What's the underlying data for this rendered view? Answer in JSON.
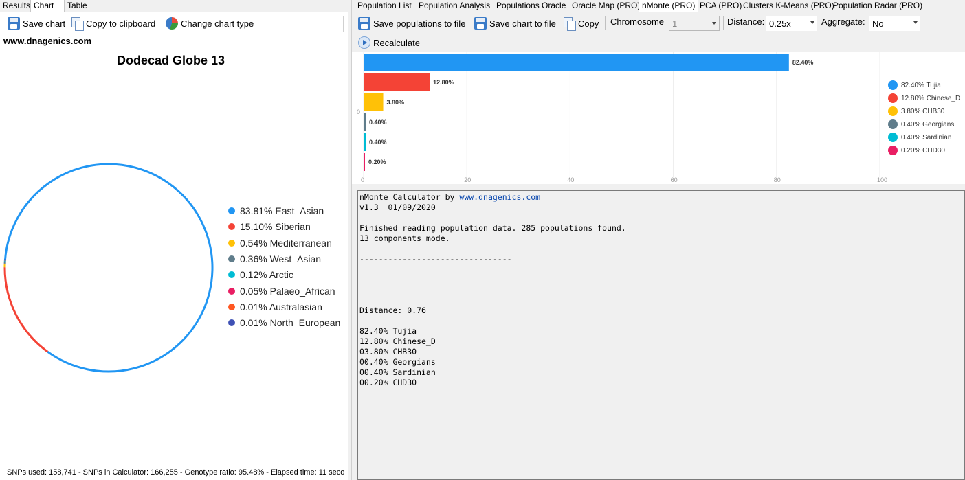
{
  "left": {
    "tabs": [
      "Results",
      "Chart",
      "Table"
    ],
    "active_tab": "Chart",
    "toolbar": {
      "save_chart": "Save chart",
      "copy_clipboard": "Copy to clipboard",
      "change_type": "Change chart type"
    },
    "site_link": "www.dnagenics.com",
    "status": "SNPs used: 158,741 - SNPs in Calculator: 166,255 - Genotype ratio: 95.48% - Elapsed time: 11 seco"
  },
  "right": {
    "tabs": [
      "Population List",
      "Population Analysis",
      "Populations Oracle",
      "Oracle Map (PRO)",
      "nMonte (PRO)",
      "PCA (PRO)",
      "Clusters K-Means (PRO)",
      "Population Radar (PRO)"
    ],
    "active_tab": "nMonte (PRO)",
    "toolbar": {
      "save_populations": "Save populations to file",
      "save_chart": "Save chart to file",
      "copy": "Copy",
      "chromosome_label": "Chromosome",
      "chromosome_value": "1",
      "distance_label": "Distance:",
      "distance_value": "0.25x",
      "aggregate_label": "Aggregate:",
      "aggregate_value": "No",
      "recalculate": "Recalculate"
    },
    "output": {
      "line1_prefix": "nMonte Calculator by ",
      "line1_link": "www.dnagenics.com",
      "lines": [
        "v1.3  01/09/2020",
        "",
        "Finished reading population data. 285 populations found.",
        "13 components mode.",
        "",
        "--------------------------------",
        "",
        "",
        "",
        "",
        "Distance: 0.76",
        "",
        "82.40% Tujia",
        "12.80% Chinese_D",
        "03.80% CHB30",
        "00.40% Georgians",
        "00.40% Sardinian",
        "00.20% CHD30"
      ]
    }
  },
  "chart_data": [
    {
      "type": "pie",
      "title": "Dodecad Globe 13",
      "style": "ring",
      "legend": "right",
      "series": [
        {
          "name": "East_Asian",
          "label": "83.81% East_Asian",
          "value": 83.81,
          "color": "#2196F3"
        },
        {
          "name": "Siberian",
          "label": "15.10% Siberian",
          "value": 15.1,
          "color": "#F44336"
        },
        {
          "name": "Mediterranean",
          "label": "0.54% Mediterranean",
          "value": 0.54,
          "color": "#FFC107"
        },
        {
          "name": "West_Asian",
          "label": "0.36% West_Asian",
          "value": 0.36,
          "color": "#607D8B"
        },
        {
          "name": "Arctic",
          "label": "0.12% Arctic",
          "value": 0.12,
          "color": "#00BCD4"
        },
        {
          "name": "Palaeo_African",
          "label": "0.05% Palaeo_African",
          "value": 0.05,
          "color": "#E91E63"
        },
        {
          "name": "Australasian",
          "label": "0.01% Australasian",
          "value": 0.01,
          "color": "#FF5722"
        },
        {
          "name": "North_European",
          "label": "0.01% North_European",
          "value": 0.01,
          "color": "#3F51B5"
        }
      ]
    },
    {
      "type": "bar",
      "orientation": "horizontal",
      "legend": "right",
      "grid": true,
      "xlim": [
        0,
        100
      ],
      "x_ticks": [
        "0",
        "20",
        "40",
        "60",
        "80",
        "100"
      ],
      "y_tick": "0",
      "series": [
        {
          "name": "Tujia",
          "value": 82.4,
          "bar_label": "82.40%",
          "legend_label": "82.40% Tujia",
          "color": "#2196F3"
        },
        {
          "name": "Chinese_D",
          "value": 12.8,
          "bar_label": "12.80%",
          "legend_label": "12.80% Chinese_D",
          "color": "#F44336"
        },
        {
          "name": "CHB30",
          "value": 3.8,
          "bar_label": "3.80%",
          "legend_label": "3.80% CHB30",
          "color": "#FFC107"
        },
        {
          "name": "Georgians",
          "value": 0.4,
          "bar_label": "0.40%",
          "legend_label": "0.40% Georgians",
          "color": "#607D8B"
        },
        {
          "name": "Sardinian",
          "value": 0.4,
          "bar_label": "0.40%",
          "legend_label": "0.40% Sardinian",
          "color": "#00BCD4"
        },
        {
          "name": "CHD30",
          "value": 0.2,
          "bar_label": "0.20%",
          "legend_label": "0.20% CHD30",
          "color": "#E91E63"
        }
      ]
    }
  ]
}
